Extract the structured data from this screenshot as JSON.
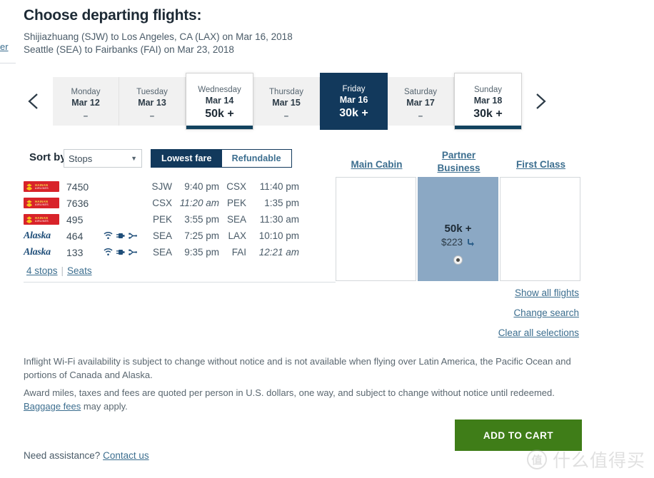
{
  "left_fragment": {
    "label": "er"
  },
  "header": {
    "title": "Choose departing flights:",
    "route_line_1": "Shijiazhuang (SJW) to Los Angeles, CA (LAX) on Mar 16, 2018",
    "route_line_2": "Seattle (SEA) to Fairbanks (FAI) on Mar 23, 2018"
  },
  "date_strip": {
    "prev_icon": "chevron-left-icon",
    "next_icon": "chevron-right-icon",
    "days": [
      {
        "dow": "Monday",
        "day": "Mar 12",
        "price": "–",
        "state": "normal"
      },
      {
        "dow": "Tuesday",
        "day": "Mar 13",
        "price": "–",
        "state": "normal"
      },
      {
        "dow": "Wednesday",
        "day": "Mar 14",
        "price": "50k +",
        "state": "selected-light"
      },
      {
        "dow": "Thursday",
        "day": "Mar 15",
        "price": "–",
        "state": "normal"
      },
      {
        "dow": "Friday",
        "day": "Mar 16",
        "price": "30k +",
        "state": "selected-dark"
      },
      {
        "dow": "Saturday",
        "day": "Mar 17",
        "price": "–",
        "state": "normal"
      },
      {
        "dow": "Sunday",
        "day": "Mar 18",
        "price": "30k +",
        "state": "selected-light"
      }
    ]
  },
  "controls": {
    "sort_label": "Sort by",
    "sort_value": "Stops",
    "sort_caret": "▼",
    "toggle_lowest": "Lowest fare",
    "toggle_refundable": "Refundable"
  },
  "fare_columns": {
    "main_cabin": "Main Cabin",
    "partner_line1": "Partner",
    "partner_line2": "Business",
    "first_class": "First Class"
  },
  "itinerary": {
    "rows": [
      {
        "airline": "hainan",
        "flight": "7450",
        "amenities": [],
        "from": "SJW",
        "depart": "9:40 pm",
        "depart_next": false,
        "to": "CSX",
        "arrive": "11:40 pm",
        "arrive_next": false
      },
      {
        "airline": "hainan",
        "flight": "7636",
        "amenities": [],
        "from": "CSX",
        "depart": "11:20 am",
        "depart_next": true,
        "to": "PEK",
        "arrive": "1:35 pm",
        "arrive_next": false
      },
      {
        "airline": "hainan",
        "flight": "495",
        "amenities": [],
        "from": "PEK",
        "depart": "3:55 pm",
        "depart_next": false,
        "to": "SEA",
        "arrive": "11:30 am",
        "arrive_next": false
      },
      {
        "airline": "alaska",
        "flight": "464",
        "amenities": [
          "wifi-icon",
          "power-outlet-icon",
          "usb-icon"
        ],
        "from": "SEA",
        "depart": "7:25 pm",
        "depart_next": false,
        "to": "LAX",
        "arrive": "10:10 pm",
        "arrive_next": false
      },
      {
        "airline": "alaska",
        "flight": "133",
        "amenities": [
          "wifi-icon",
          "power-outlet-icon",
          "usb-icon"
        ],
        "from": "SEA",
        "depart": "9:35 pm",
        "depart_next": false,
        "to": "FAI",
        "arrive": "12:21 am",
        "arrive_next": true
      }
    ],
    "stops_link": "4 stops",
    "divider": "|",
    "seats_link": "Seats",
    "hainan_name_1": "HAINAN",
    "hainan_name_2": "AIRLINES",
    "alaska_name": "Alaska"
  },
  "fare_cells": {
    "main_cabin": {
      "miles": "",
      "price": "",
      "selected": false
    },
    "partner_business": {
      "miles": "50k +",
      "price": "$223",
      "phone_icon": "phone-icon",
      "selected": true
    },
    "first_class": {
      "miles": "",
      "price": "",
      "selected": false
    }
  },
  "right_links": {
    "show_all": "Show all flights",
    "change_search": "Change search",
    "clear_all": "Clear all selections"
  },
  "disclaimers": {
    "wifi": "Inflight Wi-Fi availability is subject to change without notice and is not available when flying over Latin America, the Pacific Ocean and portions of Canada and Alaska.",
    "award_text": "Award miles, taxes and fees are quoted per person in U.S. dollars, one way, and subject to change without notice until redeemed.",
    "baggage_link": "Baggage fees",
    "award_tail": " may apply."
  },
  "footer": {
    "cart_button": "ADD TO CART",
    "assist_text": "Need assistance? ",
    "contact_link": "Contact us"
  },
  "watermark": {
    "mark": "值",
    "text": "什么值得买"
  },
  "colors": {
    "navy": "#12395c",
    "link_blue": "#3c6e8f",
    "selected_cell": "#8ba8c4",
    "cart_green": "#3f7d18",
    "hainan_red": "#d8232a"
  }
}
